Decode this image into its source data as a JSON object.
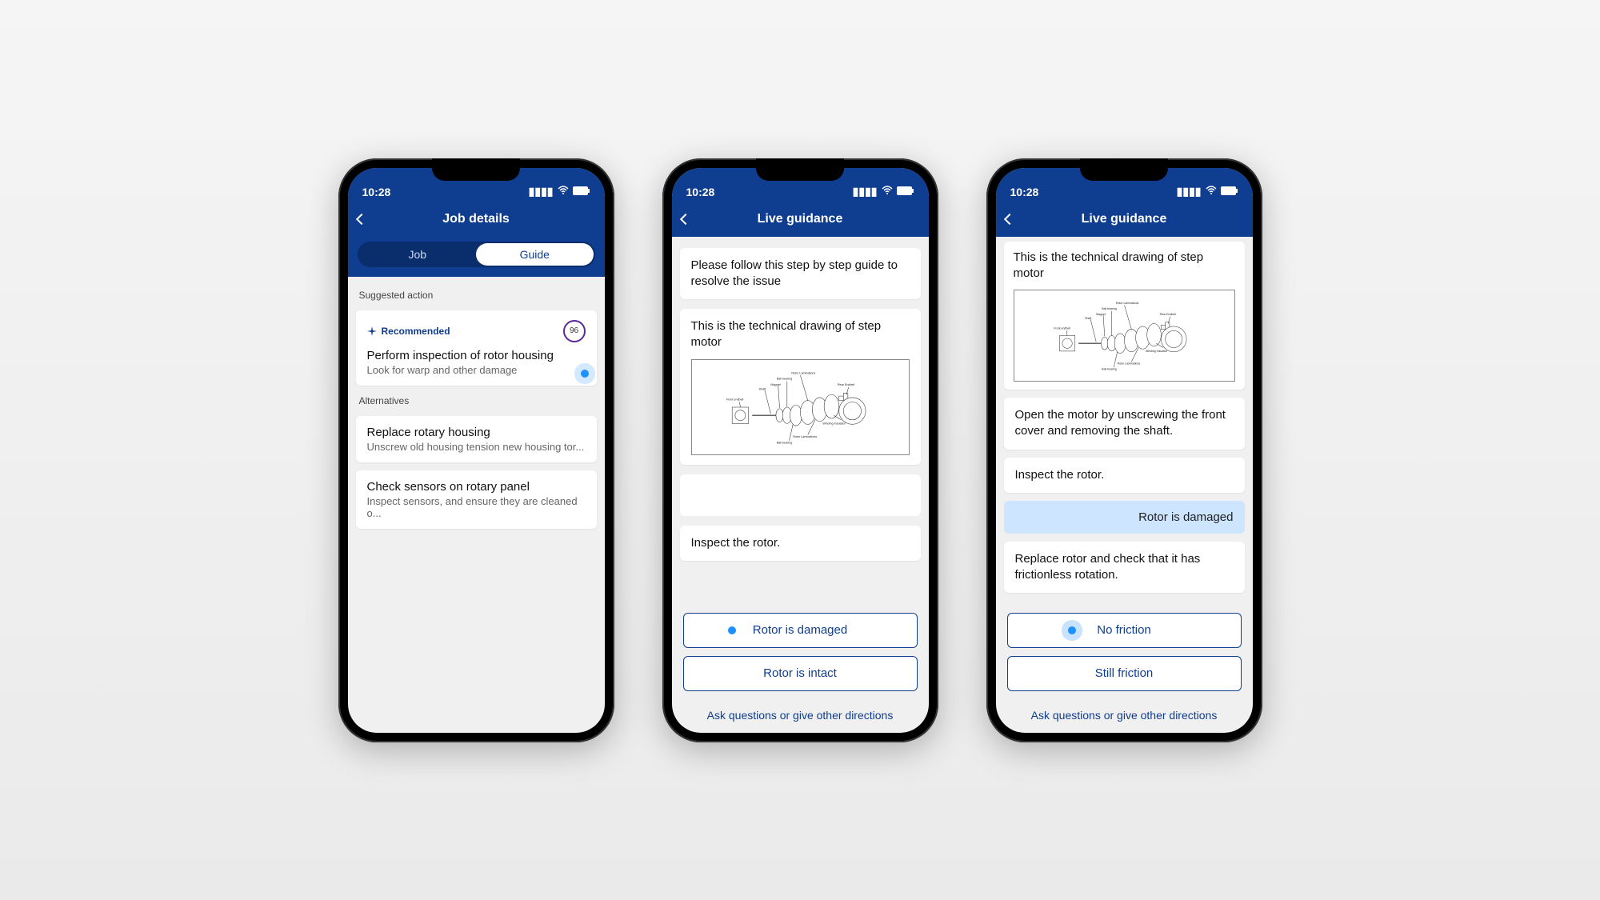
{
  "status_bar": {
    "time": "10:28"
  },
  "phone1": {
    "title": "Job details",
    "tabs": {
      "job": "Job",
      "guide": "Guide"
    },
    "section_action": "Suggested action",
    "section_alt": "Alternatives",
    "recommended_label": "Recommended",
    "score": "96",
    "action": {
      "title": "Perform inspection of rotor housing",
      "sub": "Look for warp and other damage"
    },
    "alt1": {
      "title": "Replace rotary housing",
      "sub": "Unscrew old housing tension new housing tor..."
    },
    "alt2": {
      "title": "Check sensors on rotary panel",
      "sub": "Inspect sensors, and ensure they are cleaned o..."
    }
  },
  "phone2": {
    "title": "Live guidance",
    "step_intro": "Please follow this step by step guide to resolve the issue",
    "step_drawing": "This is the technical drawing of step motor",
    "step_inspect": "Inspect the rotor.",
    "opt1": "Rotor is damaged",
    "opt2": "Rotor is intact",
    "ask": "Ask questions or give other directions"
  },
  "phone3": {
    "title": "Live guidance",
    "step_drawing": "This is the technical drawing of step motor",
    "step_open": "Open the motor by unscrewing the front cover and removing the shaft.",
    "step_inspect": "Inspect the rotor.",
    "user_msg": "Rotor is damaged",
    "step_replace": "Replace rotor and check that it has frictionless rotation.",
    "opt1": "No friction",
    "opt2": "Still friction",
    "ask": "Ask questions or give other directions"
  },
  "drawing_labels": {
    "rotor_laminations": "Rotor Laminations",
    "ball_bearing": "Ball bearing",
    "magnet": "Magnet",
    "shaft": "Shaft",
    "front_endbell": "Front endbell",
    "rear_endbell": "Rear Endbell",
    "winding_insulator": "Winding Insulator"
  }
}
